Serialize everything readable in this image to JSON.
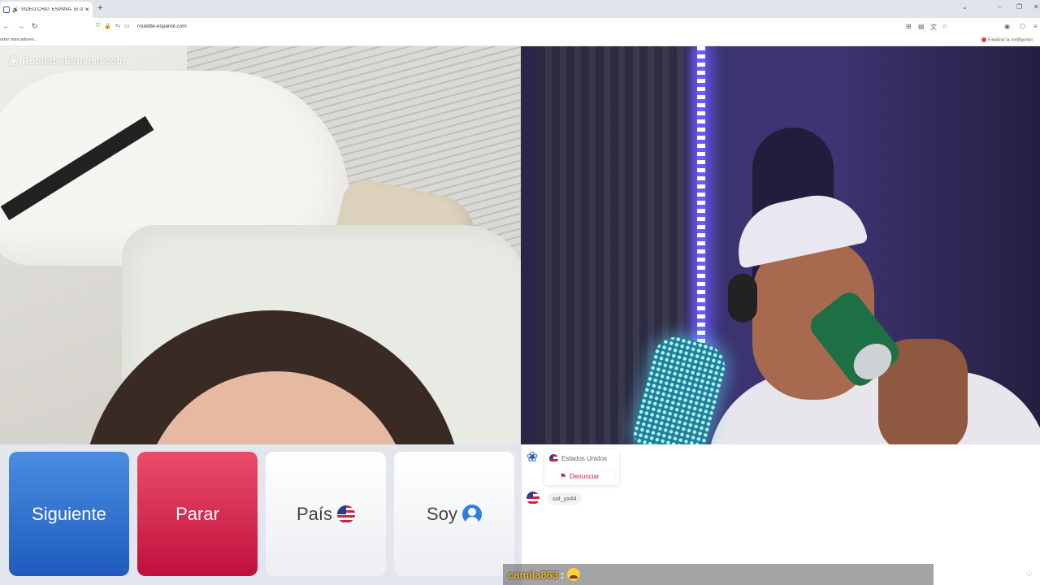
{
  "browser": {
    "tab_title": "VIDEO CHAT ESPAÑA- El ch",
    "new_tab": "+",
    "tab_close": "✕",
    "url": "roulette-espanol.com",
    "bookmarks_left": "ortar marcadores...",
    "bookmarks_right": "Finalizar la configuraci"
  },
  "video": {
    "watermark": "Roulette-Espanol.com"
  },
  "controls": {
    "next_label": "Siguiente",
    "stop_label": "Parar",
    "country_label": "País",
    "me_label": "Soy"
  },
  "chat": {
    "partner_country": "Estados Unidos",
    "report_label": "Denunciar",
    "messages": [
      {
        "user": "sol_yx44"
      }
    ]
  },
  "overlay": {
    "user": "camila863",
    "separator": ":"
  },
  "colors": {
    "next": "#2466c8",
    "stop": "#d41846",
    "report": "#c41f3b",
    "overlay_user": "#f0b530"
  }
}
